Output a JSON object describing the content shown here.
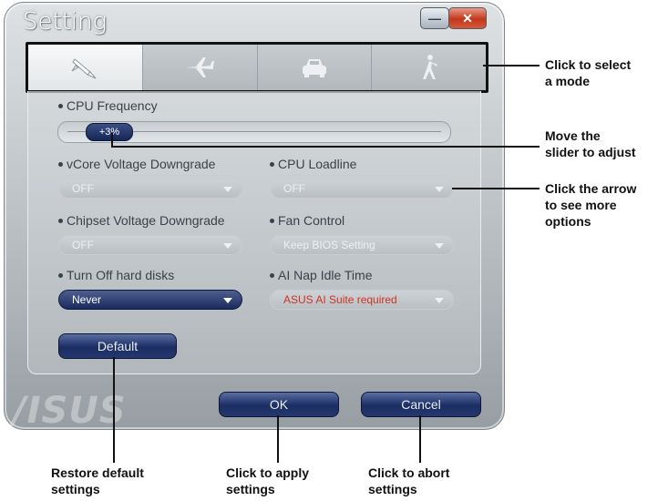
{
  "window": {
    "title": "Setting",
    "minimize_label": "—",
    "close_label": "✕"
  },
  "tabs": [
    {
      "icon": "rocket-icon",
      "active": true
    },
    {
      "icon": "airplane-icon",
      "active": false
    },
    {
      "icon": "car-icon",
      "active": false
    },
    {
      "icon": "walking-person-icon",
      "active": false
    }
  ],
  "cpu_frequency": {
    "label": "CPU Frequency",
    "value": "+3%"
  },
  "fields": {
    "vcore": {
      "label": "vCore Voltage Downgrade",
      "value": "OFF"
    },
    "loadline": {
      "label": "CPU Loadline",
      "value": "OFF"
    },
    "chipset": {
      "label": "Chipset Voltage Downgrade",
      "value": "OFF"
    },
    "fan": {
      "label": "Fan Control",
      "value": "Keep BIOS Setting"
    },
    "hdd": {
      "label": "Turn Off hard disks",
      "value": "Never"
    },
    "ainap": {
      "label": "AI Nap Idle Time",
      "value": "ASUS AI Suite required"
    }
  },
  "buttons": {
    "default": "Default",
    "ok": "OK",
    "cancel": "Cancel"
  },
  "logo": "/ISUS",
  "callouts": {
    "select_mode": "Click to select\na mode",
    "slider": "Move the\nslider to adjust",
    "arrow": "Click the arrow\nto see more\noptions",
    "restore": "Restore default\nsettings",
    "apply": "Click to apply\nsettings",
    "abort": "Click to abort\nsettings"
  },
  "colors": {
    "accent_navy": "#1b2d63",
    "warning_red": "#d2321f"
  }
}
